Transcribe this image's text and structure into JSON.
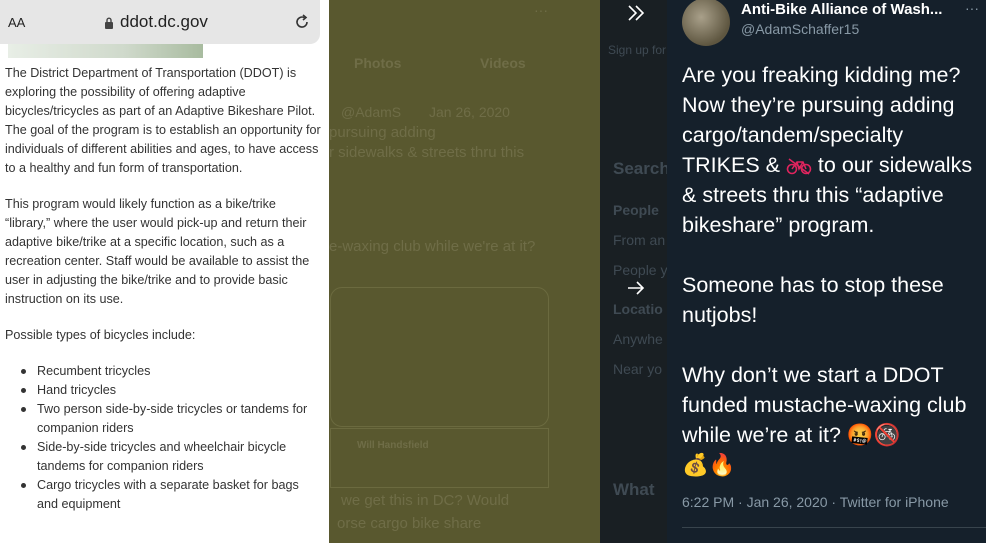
{
  "browser": {
    "text_size_label": "AA",
    "domain": "ddot.dc.gov"
  },
  "article": {
    "paragraph1": "The District Department of Transportation (DDOT) is exploring the possibility of offering adaptive bicycles/tricycles as part of an Adaptive Bikeshare Pilot. The goal of the program is to establish an opportunity for individuals of different abilities and ages, to have access to a healthy and fun form of transportation.",
    "paragraph2": "This program would likely function as a bike/trike “library,” where the user would pick-up and return their adaptive bike/trike at a specific location, such as a recreation center. Staff would be available to assist the user in adjusting the bike/trike and to provide basic instruction on its use.",
    "types_heading": "Possible types of bicycles include:",
    "types": [
      "Recumbent tricycles",
      "Hand tricycles",
      "Two person side-by-side tricycles or tandems for companion riders",
      "Side-by-side tricycles and wheelchair bicycle tandems for companion riders",
      "Cargo tricycles with a separate basket for bags and equipment"
    ]
  },
  "background": {
    "tab_photos": "Photos",
    "tab_videos": "Videos",
    "sign_up": "Sign up for",
    "search_heading": "Search",
    "people": "People",
    "from_anyone": "From an",
    "people_you_follow": "People y",
    "location": "Locatio",
    "anywhere": "Anywhe",
    "near_you": "Near yo",
    "whats_happening": "What",
    "ghost_user": "Will Handsfield",
    "ghost_line1": "pursuing adding",
    "ghost_line2": "r sidewalks & streets thru this",
    "ghost_line3": "e-waxing club while we're at it?",
    "ghost_line4": "we get this in DC? Would",
    "ghost_line5": "orse cargo bike share",
    "ghost_handle": "@AdamS",
    "ghost_date": "Jan 26, 2020",
    "ghost_more": "···"
  },
  "tweet": {
    "author_name": "Anti-Bike Alliance of Wash...",
    "author_handle": "@AdamSchaffer15",
    "more": "···",
    "line1": "Are you freaking kidding me? Now they’re pursuing adding cargo/tandem/specialty TRIKES &",
    "line1b": " to our sidewalks & streets thru this “adaptive bikeshare” program.",
    "line2": "Someone has to stop these nutjobs!",
    "line3": "Why don’t we start a DDOT funded mustache-waxing club while we’re at it?",
    "emoji_line3": "🤬🚳",
    "emoji_line4": "💰🔥",
    "timestamp": "6:22 PM · Jan 26, 2020 · Twitter for iPhone"
  },
  "colors": {
    "tweet_bg": "#15202b",
    "secondary_text": "#8899a6",
    "dim_overlay": "#59582f"
  }
}
